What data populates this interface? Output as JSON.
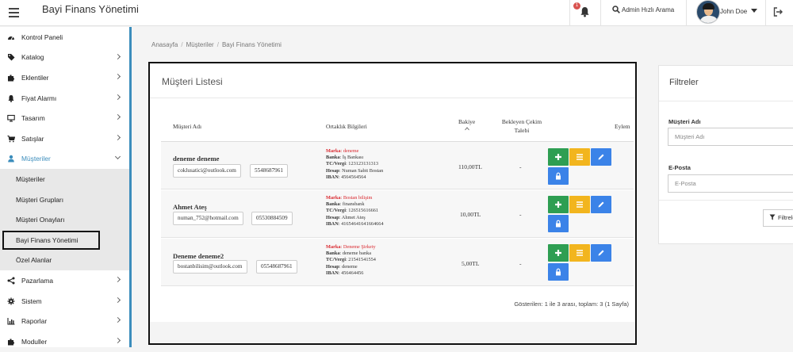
{
  "header": {
    "title": "Bayi Finans Yönetimi",
    "notification_count": "1",
    "search_label": "Admin Hızlı Arama",
    "user_name": "John Doe"
  },
  "sidebar": {
    "items": [
      {
        "label": "Kontrol Paneli",
        "icon": "dashboard-icon"
      },
      {
        "label": "Katalog",
        "icon": "tag-icon"
      },
      {
        "label": "Eklentiler",
        "icon": "puzzle-icon"
      },
      {
        "label": "Fiyat Alarmı",
        "icon": "bell-icon"
      },
      {
        "label": "Tasarım",
        "icon": "desktop-icon"
      },
      {
        "label": "Satışlar",
        "icon": "cart-icon"
      },
      {
        "label": "Müşteriler",
        "icon": "user-icon"
      }
    ],
    "submenu": [
      "Müşteriler",
      "Müşteri Grupları",
      "Müşteri Onayları",
      "Bayi Finans Yönetimi",
      "Özel Alanlar"
    ],
    "items_after": [
      {
        "label": "Pazarlama",
        "icon": "share-icon"
      },
      {
        "label": "Sistem",
        "icon": "cog-icon"
      },
      {
        "label": "Raporlar",
        "icon": "chart-icon"
      },
      {
        "label": "Moduller",
        "icon": "puzzle-icon"
      }
    ]
  },
  "breadcrumb": [
    "Anasayfa",
    "Müşteriler",
    "Bayi Finans Yönetimi"
  ],
  "list": {
    "title": "Müşteri Listesi",
    "columns": {
      "name": "Müşteri Adı",
      "partner": "Ortaklık Bilgileri",
      "balance": "Bakiye",
      "pending_1": "Bekleyen Çekim",
      "pending_2": "Talebi",
      "action": "Eylem"
    },
    "field_labels": {
      "brand": "Marka",
      "bank": "Banka",
      "tc": "TC/Vergi",
      "account": "Hesap",
      "iban": "IBAN"
    },
    "rows": [
      {
        "name": "deneme deneme",
        "email": "coklusatici@outlook.com",
        "phone": "5548687961",
        "brand": "deneme",
        "bank": "İş Bankası",
        "tc": "123123131313",
        "account": "Numan Sabit Bostan",
        "iban": "4564564564",
        "balance": "110,00TL",
        "pending": "-"
      },
      {
        "name": "Ahmet Ateş",
        "email": "numan_752@hotmail.com",
        "phone": "05530884509",
        "brand": "Bostan bilişim",
        "bank": "finansbank",
        "tc": "126515616661",
        "account": "Ahmet Ateş",
        "iban": "41654641641664664",
        "balance": "10,00TL",
        "pending": "-"
      },
      {
        "name": "Deneme deneme2",
        "email": "bostanbilisim@outlook.com",
        "phone": "05548687961",
        "brand": "Deneme Şirkety",
        "bank": "deneme banka",
        "tc": "21541541554",
        "account": "deneme",
        "iban": "456464456",
        "balance": "5,00TL",
        "pending": "-"
      }
    ],
    "footer": "Gösterilen: 1 ile 3 arası, toplam: 3 (1 Sayfa)"
  },
  "filters": {
    "title": "Filtreler",
    "customer_label": "Müşteri Adı",
    "customer_placeholder": "Müşteri Adı",
    "email_label": "E-Posta",
    "email_placeholder": "E-Posta",
    "button": "Filtrele"
  },
  "colors": {
    "accent": "#3c8dbc",
    "green": "#2e9e52",
    "yellow": "#f2b51e",
    "blue": "#3b83e8",
    "brand_red": "#d9272e"
  }
}
